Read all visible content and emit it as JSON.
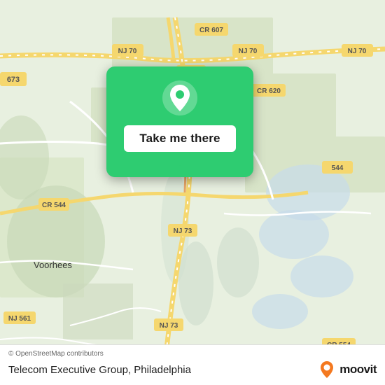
{
  "map": {
    "attribution": "© OpenStreetMap contributors",
    "location_title": "Telecom Executive Group, Philadelphia",
    "take_me_there_label": "Take me there",
    "moovit_text": "moovit",
    "background_color": "#e8f0e0"
  },
  "roads": {
    "nj70_label": "NJ 70",
    "cr607_label": "CR 607",
    "cr620_label": "CR 620",
    "nj73_label": "NJ 73",
    "cr544_label": "CR 544",
    "cr554_label": "CR 554",
    "nj73_south_label": "NJ 73",
    "r673_label": "673",
    "r561_label": "NJ 561",
    "voorhees_label": "Voorhees"
  },
  "colors": {
    "green_btn": "#2ecc71",
    "road_yellow": "#f5d76e",
    "road_white": "#ffffff",
    "land": "#e8f0e0",
    "water": "#b8d4e8",
    "urban": "#dde8c8"
  }
}
